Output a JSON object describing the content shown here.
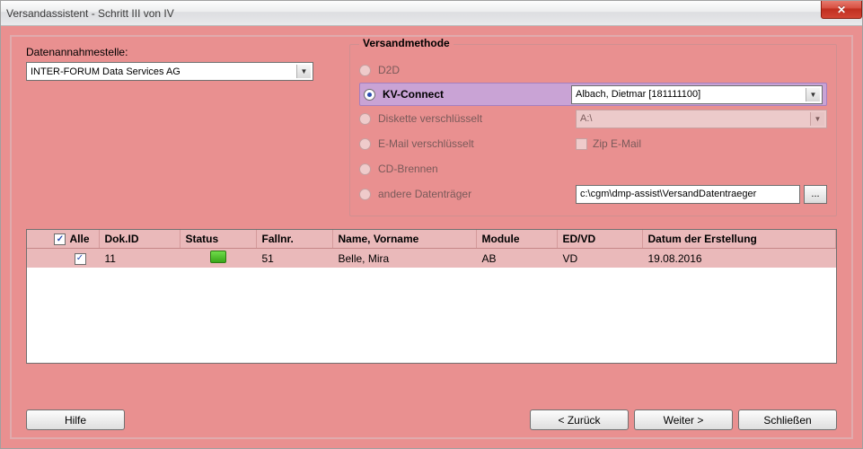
{
  "window": {
    "title": "Versandassistent - Schritt III von IV"
  },
  "datenannahme": {
    "label": "Datenannahmestelle:",
    "value": "INTER-FORUM Data Services AG"
  },
  "versandmethode": {
    "legend": "Versandmethode",
    "d2d": "D2D",
    "kvconnect": "KV-Connect",
    "kvconnect_recipient": "Albach, Dietmar [181111100]",
    "diskette": "Diskette verschlüsselt",
    "diskette_drive": "A:\\",
    "email": "E-Mail verschlüsselt",
    "zip_email": "Zip E-Mail",
    "cd": "CD-Brennen",
    "andere": "andere Datenträger",
    "andere_path": "c:\\cgm\\dmp-assist\\VersandDatentraeger",
    "browse": "..."
  },
  "table": {
    "headers": {
      "alle": "Alle",
      "dokid": "Dok.ID",
      "status": "Status",
      "fallnr": "Fallnr.",
      "name": "Name, Vorname",
      "module": "Module",
      "edvd": "ED/VD",
      "datum": "Datum der Erstellung"
    },
    "row": {
      "dokid": "11",
      "fallnr": "51",
      "name": "Belle, Mira",
      "module": "AB",
      "edvd": "VD",
      "datum": "19.08.2016"
    }
  },
  "buttons": {
    "hilfe": "Hilfe",
    "zurueck": "< Zurück",
    "weiter": "Weiter >",
    "schliessen": "Schließen"
  }
}
